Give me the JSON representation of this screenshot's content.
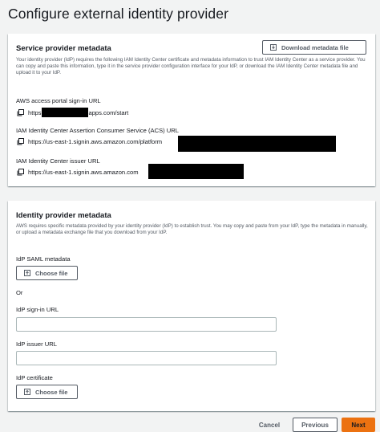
{
  "page": {
    "title": "Configure external identity provider"
  },
  "service_provider": {
    "title": "Service provider metadata",
    "download_button": "Download metadata file",
    "description": "Your identity provider (IdP) requires the following IAM Identity Center certificate and metadata information to trust IAM Identity Center as a service provider. You can copy and paste this information, type it in the service provider configuration interface for your IdP, or download the IAM Identity Center metadata file and upload it to your IdP.",
    "fields": [
      {
        "label": "AWS access portal sign-in URL",
        "value_prefix": "https",
        "value_suffix": "apps.com/start"
      },
      {
        "label": "IAM Identity Center Assertion Consumer Service (ACS) URL",
        "value_prefix": "https://us-east-1.signin.aws.amazon.com/platform"
      },
      {
        "label": "IAM Identity Center issuer URL",
        "value_prefix": "https://us-east-1.signin.aws.amazon.com"
      }
    ]
  },
  "identity_provider": {
    "title": "Identity provider metadata",
    "description": "AWS requires specific metadata provided by your identity provider (IdP) to establish trust. You may copy and paste from your IdP, type the metadata in manually, or upload a metadata exchange file that you download from your IdP.",
    "saml_label": "IdP SAML metadata",
    "choose_file": "Choose file",
    "or_text": "Or",
    "signin_label": "IdP sign-in URL",
    "signin_value": "",
    "issuer_label": "IdP issuer URL",
    "issuer_value": "",
    "certificate_label": "IdP certificate",
    "certificate_choose_file": "Choose file"
  },
  "footer": {
    "cancel": "Cancel",
    "previous": "Previous",
    "next": "Next"
  },
  "colors": {
    "accent": "#ec7211",
    "background": "#f2f3f3",
    "border": "#545b64"
  },
  "icons": [
    "download-icon",
    "copy-icon",
    "upload-icon"
  ]
}
